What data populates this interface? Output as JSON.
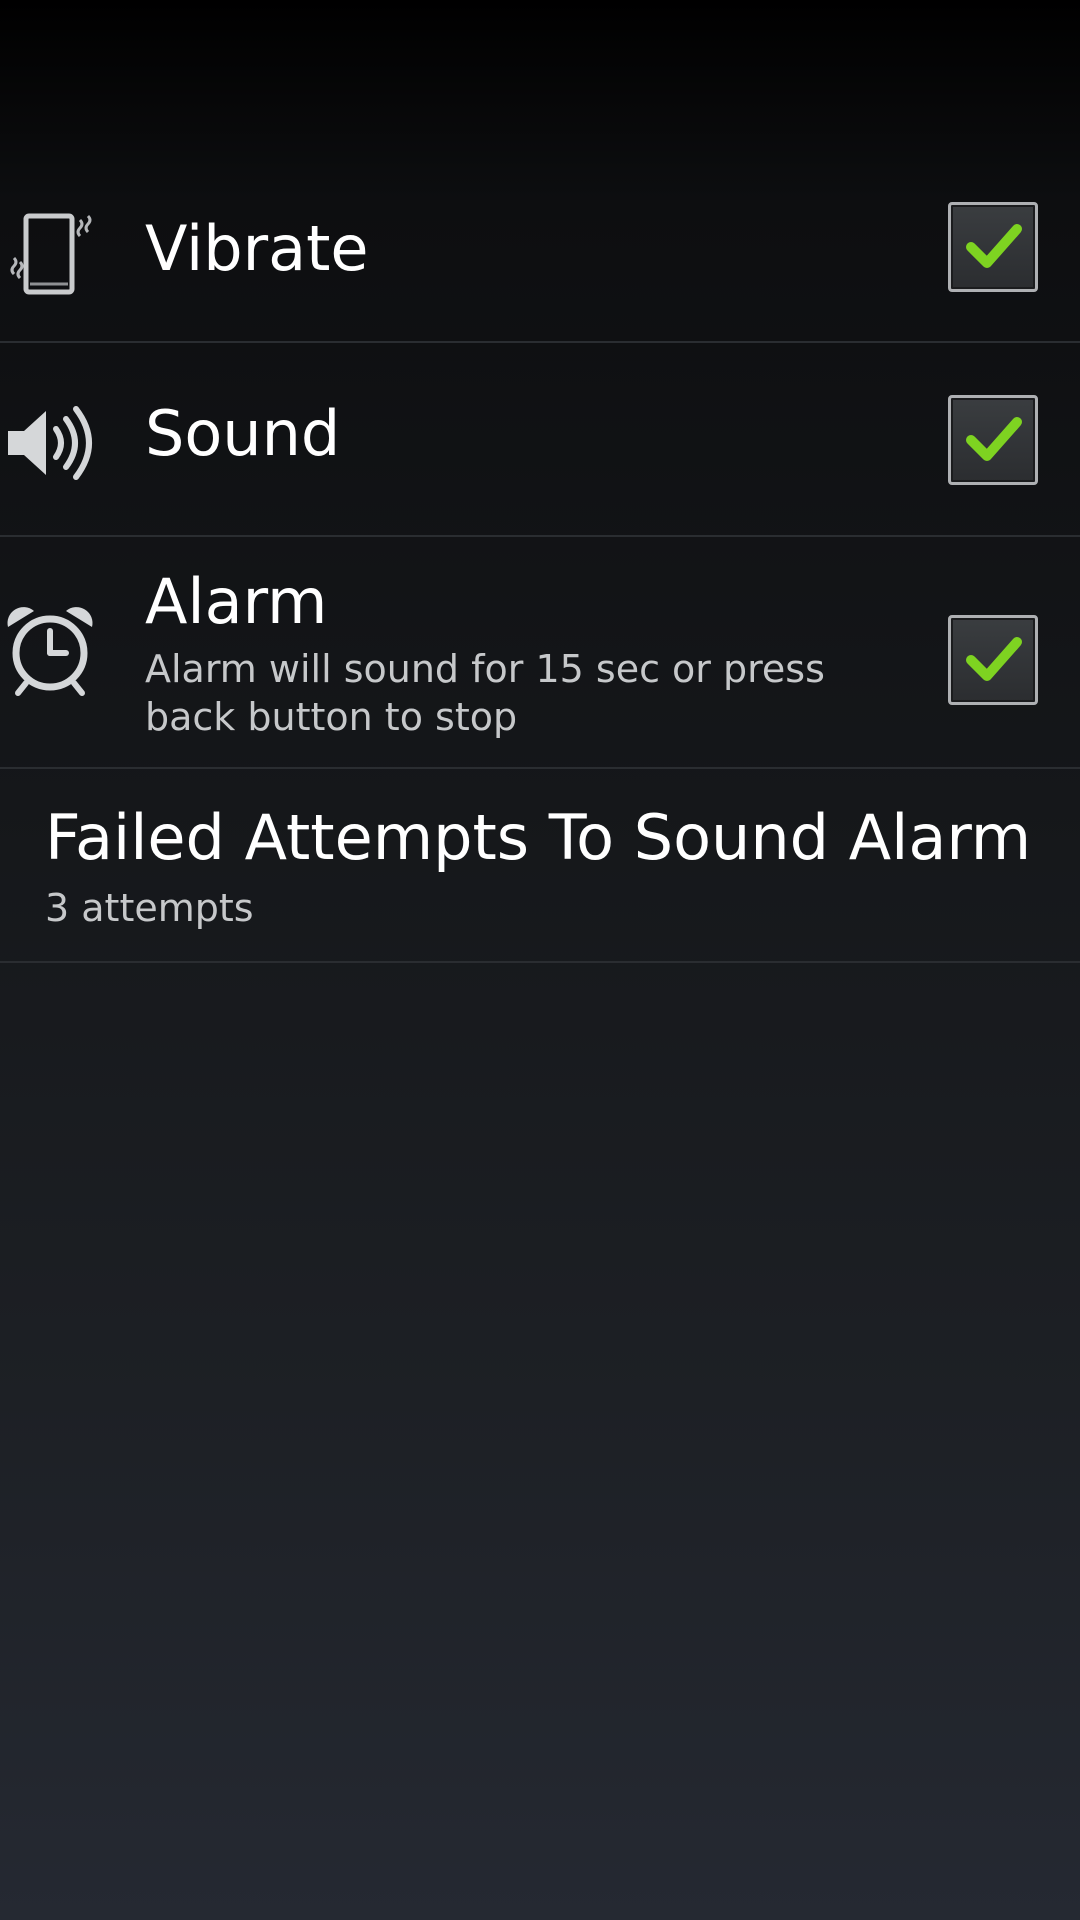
{
  "settings": {
    "vibrate": {
      "title": "Vibrate",
      "icon": "vibrate-phone-icon",
      "checked": true
    },
    "sound": {
      "title": "Sound",
      "icon": "speaker-icon",
      "checked": true
    },
    "alarm": {
      "title": "Alarm",
      "summary": "Alarm will sound for 15 sec or press back button to stop",
      "icon": "alarm-clock-icon",
      "checked": true
    },
    "failed_attempts": {
      "title": "Failed Attempts To Sound Alarm",
      "summary": "3 attempts"
    }
  },
  "colors": {
    "check_mark": "#7ed321",
    "summary_text": "#c6c8ca",
    "divider": "#2a2d31"
  }
}
